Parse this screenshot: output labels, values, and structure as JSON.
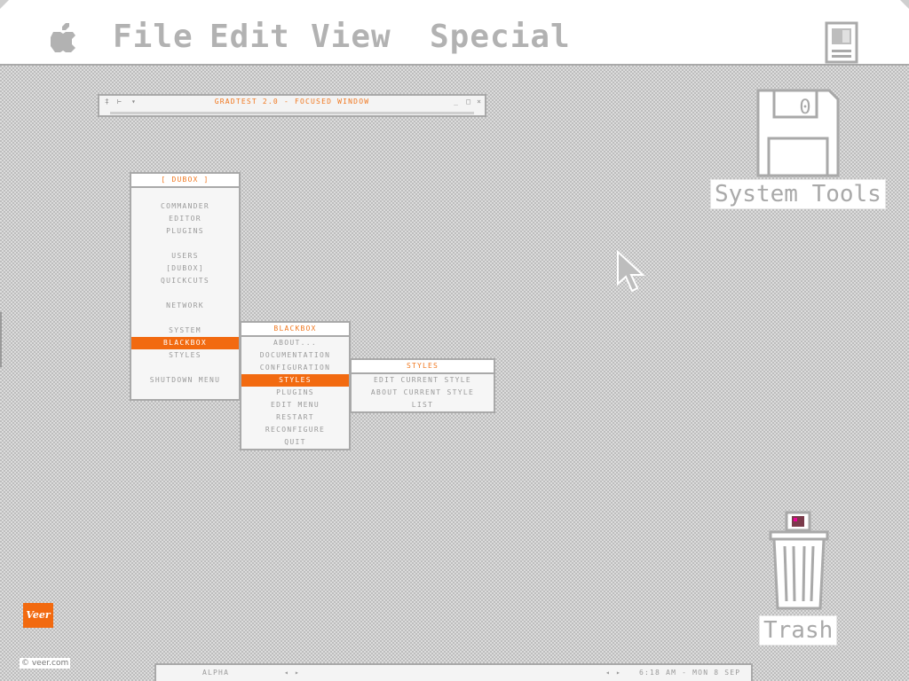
{
  "menubar": {
    "apple_icon": "apple-icon",
    "items": [
      "File",
      "Edit",
      "View",
      "Special"
    ],
    "system_icon": "system-icon"
  },
  "focused_window": {
    "title": "GRADTEST 2.0 - FOCUSED WINDOW",
    "left_buttons": [
      "‡",
      "⊢",
      "▾"
    ],
    "right_buttons": [
      "_",
      "□",
      "×"
    ]
  },
  "root_menu": {
    "title": "[ DUBOX ]",
    "items": [
      "COMMANDER",
      "EDITOR",
      "PLUGINS",
      "",
      "USERS",
      "[DUBOX]",
      "QUICKCUTS",
      "",
      "NETWORK",
      "",
      "SYSTEM",
      "BLACKBOX",
      "STYLES",
      "",
      "SHUTDOWN MENU"
    ],
    "selected": "BLACKBOX"
  },
  "blackbox_menu": {
    "title": "BLACKBOX",
    "items": [
      "ABOUT...",
      "DOCUMENTATION",
      "CONFIGURATION",
      "STYLES",
      "PLUGINS",
      "EDIT MENU",
      "RESTART",
      "RECONFIGURE",
      "QUIT"
    ],
    "selected": "STYLES"
  },
  "styles_menu": {
    "title": "STYLES",
    "items": [
      "EDIT CURRENT STYLE",
      "ABOUT CURRENT STYLE",
      "LIST"
    ]
  },
  "desktop_icons": {
    "system_tools": {
      "label": "System Tools",
      "icon": "floppy-disk-icon",
      "disk_mark": "0"
    },
    "trash": {
      "label": "Trash",
      "icon": "trash-can-icon"
    }
  },
  "toolbar": {
    "workspace": "ALPHA",
    "workspace_arrows": "◂ ▸",
    "window_arrows": "◂ ▸",
    "clock": "6:18 AM - MON 8 SEP"
  },
  "branding": {
    "logo": "Veer",
    "watermark": "© veer.com"
  },
  "colors": {
    "accent": "#f26a10",
    "text_gray": "#9a9a9a",
    "border": "#a9a9a9"
  }
}
